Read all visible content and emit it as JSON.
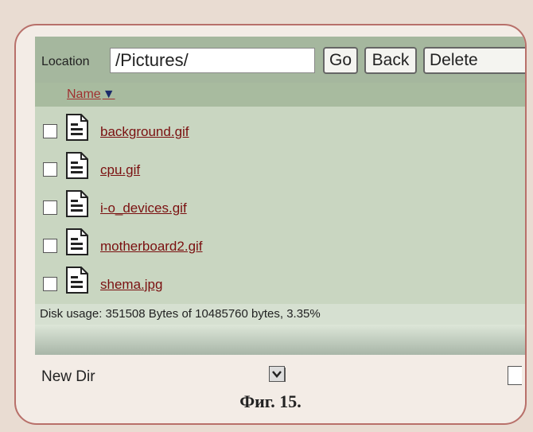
{
  "location": {
    "label": "Location",
    "value": "/Pictures/"
  },
  "toolbar": {
    "go_label": "Go",
    "back_label": "Back",
    "delete_label": "Delete"
  },
  "list": {
    "name_header": "Name",
    "sort_indicator": "▼",
    "files": [
      {
        "name": "background.gif"
      },
      {
        "name": "cpu.gif"
      },
      {
        "name": "i-o_devices.gif"
      },
      {
        "name": "motherboard2.gif"
      },
      {
        "name": "shema.jpg"
      }
    ]
  },
  "status": {
    "disk_usage": "Disk usage: 351508 Bytes of 10485760 bytes, 3.35%"
  },
  "footer": {
    "new_dir_label": "New Dir"
  },
  "caption": "Фиг. 15.",
  "colors": {
    "link": "#7a1010",
    "toolbar": "#a5b79e",
    "list": "#c9d6c1"
  }
}
